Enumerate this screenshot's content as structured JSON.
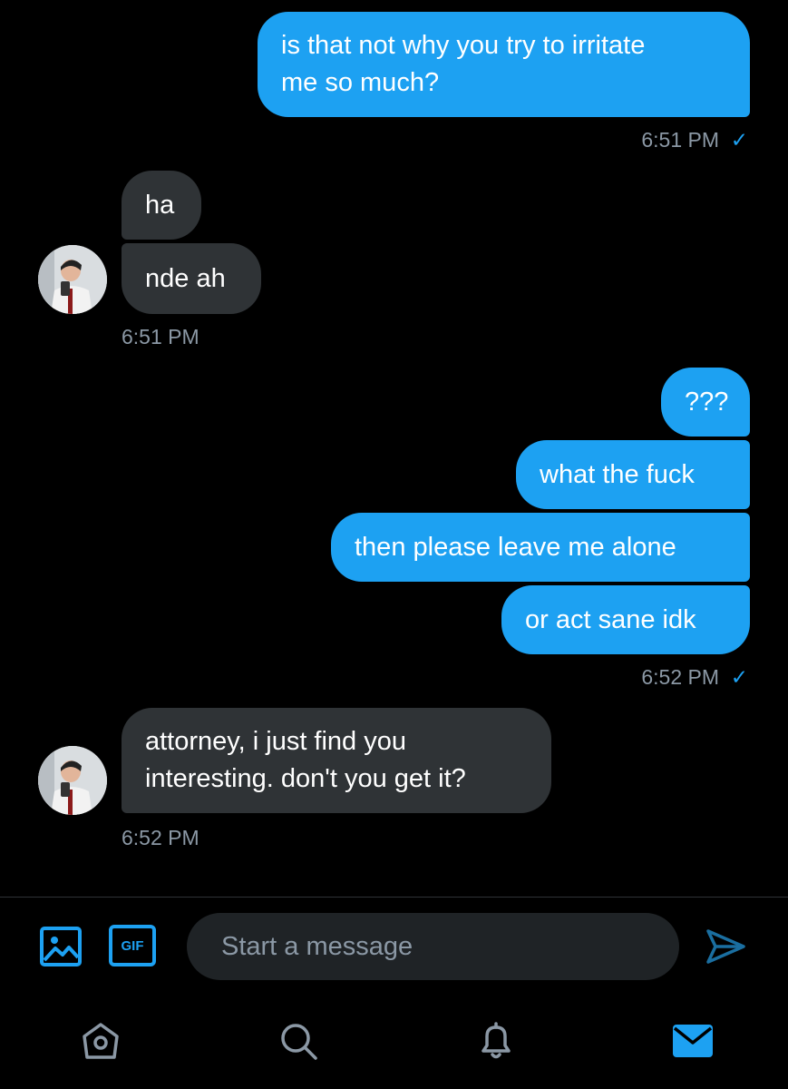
{
  "messages": {
    "m1": "is that not why you try to irritate\nme so much?",
    "m1_time": "6:51 PM",
    "m2a": "ha",
    "m2b": "nde ah",
    "m2_time": "6:51 PM",
    "m3a": "???",
    "m3b": "what the fuck",
    "m3c": "then please leave me alone",
    "m3d": "or act sane idk",
    "m3_time": "6:52 PM",
    "m4": "attorney, i just find you\ninteresting. don't you get it?",
    "m4_time": "6:52 PM",
    "read_mark": "✓"
  },
  "composer": {
    "placeholder": "Start a message",
    "gif_label": "GIF"
  },
  "colors": {
    "accent": "#1da1f2",
    "incoming_bubble": "#2f3336",
    "timestamp": "#8b98a5",
    "background": "#000000"
  },
  "icons": {
    "media": "image-icon",
    "gif": "gif-icon",
    "send": "send-icon",
    "home": "home-icon",
    "search": "search-icon",
    "notifications": "bell-icon",
    "messages": "mail-icon"
  }
}
